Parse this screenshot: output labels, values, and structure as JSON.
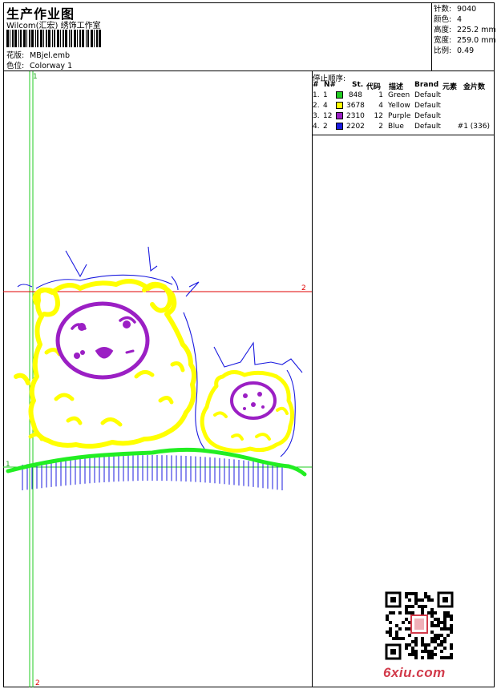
{
  "header": {
    "title": "生产作业图",
    "company": "Wilcom(汇宏) 绣饰工作室",
    "design_label": "花版:",
    "design_value": "MBjel.emb",
    "colorway_label": "色位:",
    "colorway_value": "Colorway 1"
  },
  "stats": {
    "stitches_label": "针数:",
    "stitches_value": "9040",
    "colors_label": "颜色:",
    "colors_value": "4",
    "height_label": "高度:",
    "height_value": "225.2 mm",
    "width_label": "宽度:",
    "width_value": "259.0 mm",
    "scale_label": "比例:",
    "scale_value": "0.49"
  },
  "stop_sequence": {
    "title": "停止顺序:",
    "headers": [
      "#",
      "N#",
      "St.",
      "代码",
      "描述",
      "Brand",
      "元素",
      "金片数"
    ],
    "rows": [
      {
        "index": "1.",
        "needle": "1",
        "stitches": "848",
        "code": "1",
        "desc": "Green",
        "brand": "Default",
        "elements": "",
        "sequins": "",
        "color": "#22cc22"
      },
      {
        "index": "2.",
        "needle": "4",
        "stitches": "3678",
        "code": "4",
        "desc": "Yellow",
        "brand": "Default",
        "elements": "",
        "sequins": "",
        "color": "#ffff00"
      },
      {
        "index": "3.",
        "needle": "12",
        "stitches": "2310",
        "code": "12",
        "desc": "Purple",
        "brand": "Default",
        "elements": "",
        "sequins": "",
        "color": "#9b1fc4"
      },
      {
        "index": "4.",
        "needle": "2",
        "stitches": "2202",
        "code": "2",
        "desc": "Blue",
        "brand": "Default",
        "elements": "",
        "sequins": "#1 (336)",
        "color": "#1a1adf"
      }
    ]
  },
  "guides": {
    "vertical_top_label": "1",
    "vertical_bottom_label": "2",
    "horizontal_left_label": "1",
    "horizontal_right_label": "2",
    "green_guide_color": "#22cc22",
    "red_guide_color": "#e00000"
  },
  "watermark": {
    "text": "6xiu.com",
    "color": "#d23a4a"
  },
  "thread_colors": {
    "green": "#22ee22",
    "yellow": "#ffff00",
    "purple": "#9b1fc4",
    "blue": "#1a1adf"
  }
}
